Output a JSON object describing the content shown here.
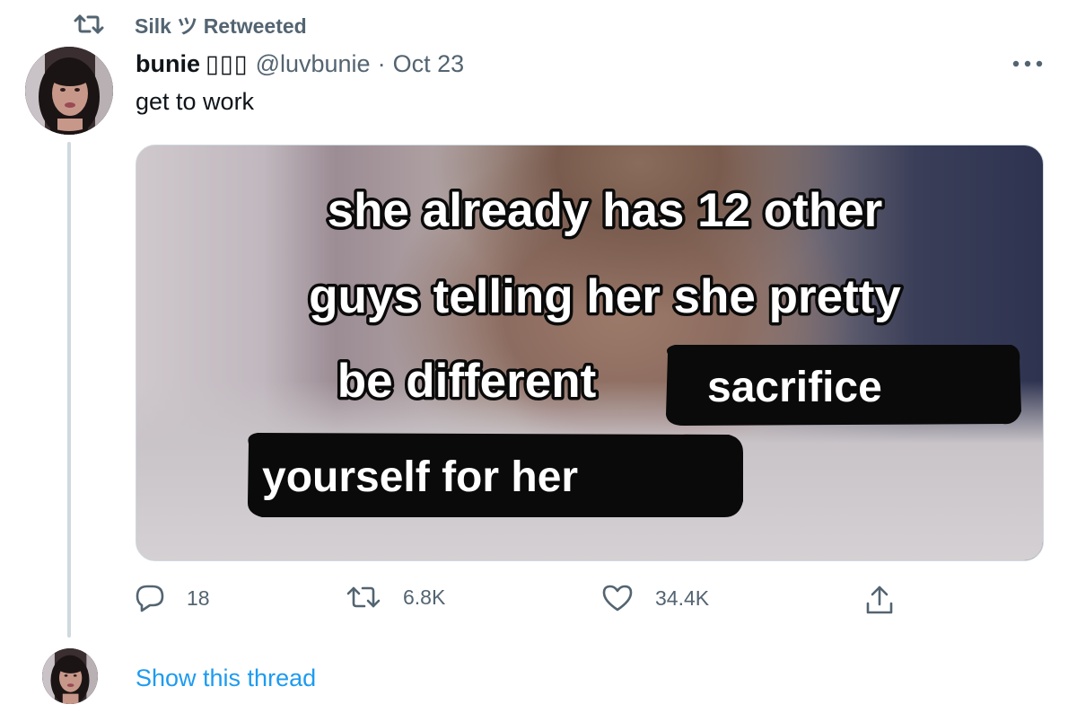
{
  "retweet_header": {
    "text": "Silk ツ Retweeted",
    "icon": "retweet-icon"
  },
  "tweet": {
    "display_name": "bunie",
    "name_emoji": "▯▯▯",
    "handle": "@luvbunie",
    "separator": "·",
    "date": "Oct 23",
    "text": "get to work",
    "more_icon": "more-icon"
  },
  "media": {
    "overlay_lines": [
      "she already has 12 other",
      "guys telling her she pretty",
      "be different"
    ],
    "caption_boxes": [
      "sacrifice",
      "yourself for her"
    ]
  },
  "actions": {
    "reply": {
      "icon": "reply-icon",
      "count": "18"
    },
    "retweet": {
      "icon": "retweet-icon",
      "count": "6.8K"
    },
    "like": {
      "icon": "heart-icon",
      "count": "34.4K"
    },
    "share": {
      "icon": "share-icon"
    }
  },
  "show_thread": "Show this thread",
  "colors": {
    "secondary_text": "#536471",
    "link": "#1d9bf0",
    "line": "#cfd9de"
  }
}
